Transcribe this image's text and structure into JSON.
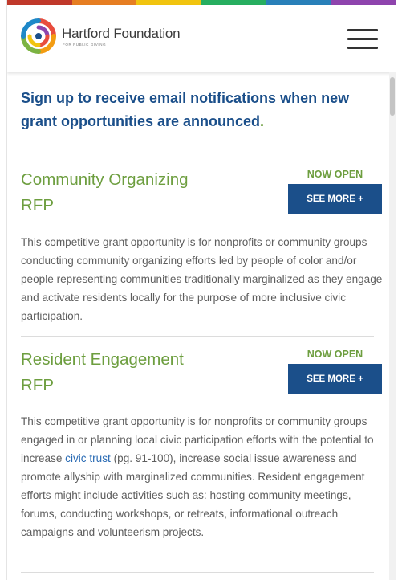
{
  "header": {
    "logo_name": "Hartford Foundation",
    "logo_tagline": "FOR PUBLIC GIVING",
    "menu_icon": "hamburger-menu-icon",
    "logo_icon": "hartford-foundation-spiral-logo",
    "rainbow_colors": [
      "#c0392b",
      "#e67e22",
      "#f1c40f",
      "#27ae60",
      "#2980b9",
      "#8e44ad"
    ]
  },
  "main": {
    "signup_text": "Sign up to receive email notifications when new grant opportunities are announced",
    "signup_period": ".",
    "rfps": [
      {
        "title_line1": "Community Organizing",
        "title_line2": "RFP",
        "status": "NOW OPEN",
        "button": "SEE MORE +",
        "description": "This competitive grant opportunity is for nonprofits or community groups conducting community organizing efforts led by people of color and/or people representing communities traditionally marginalized as they engage and activate residents locally for the purpose of more inclusive civic participation."
      },
      {
        "title_line1": "Resident Engagement",
        "title_line2": "RFP",
        "status": "NOW OPEN",
        "button": "SEE MORE +",
        "description_before_link": "This competitive grant opportunity is for nonprofits or community groups engaged in or planning local civic participation efforts with the potential to increase ",
        "description_link": "civic trust",
        "description_after_link": " (pg. 91-100), increase social issue awareness and promote allyship with marginalized communities. Resident engagement efforts might include activities such as: hosting community meetings, forums, conducting workshops, or retreats, informational outreach campaigns and volunteerism projects."
      }
    ]
  },
  "colors": {
    "brand_blue": "#1b4f8a",
    "brand_green": "#6d9e3f",
    "link_blue": "#2a6bb4",
    "body_text": "#5e5e5e"
  }
}
